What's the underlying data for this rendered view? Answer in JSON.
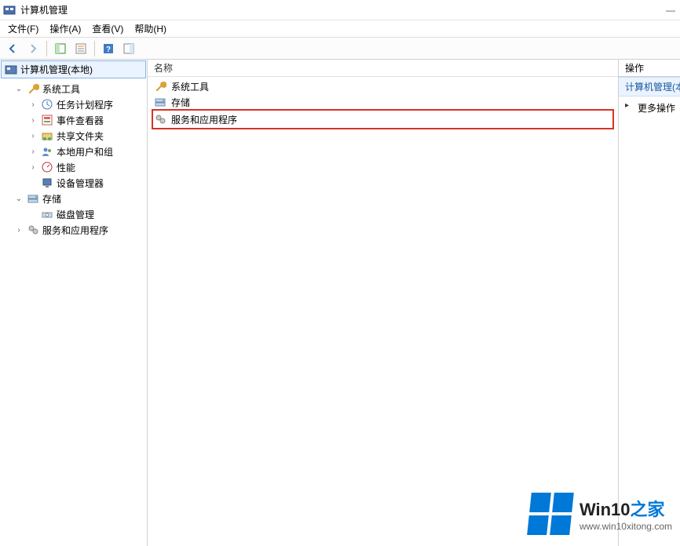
{
  "window": {
    "title": "计算机管理"
  },
  "menus": {
    "file": "文件(F)",
    "action": "操作(A)",
    "view": "查看(V)",
    "help": "帮助(H)"
  },
  "tree": {
    "root": "计算机管理(本地)",
    "system_tools": "系统工具",
    "task_scheduler": "任务计划程序",
    "event_viewer": "事件查看器",
    "shared_folders": "共享文件夹",
    "local_users": "本地用户和组",
    "performance": "性能",
    "device_manager": "设备管理器",
    "storage": "存储",
    "disk_management": "磁盘管理",
    "services_apps": "服务和应用程序"
  },
  "list": {
    "header_name": "名称",
    "items": {
      "system_tools": "系统工具",
      "storage": "存储",
      "services_apps": "服务和应用程序"
    }
  },
  "actions": {
    "header": "操作",
    "context": "计算机管理(本地)",
    "more": "更多操作"
  },
  "watermark": {
    "brand_prefix": "Win10",
    "brand_suffix": "之家",
    "url": "www.win10xitong.com"
  }
}
